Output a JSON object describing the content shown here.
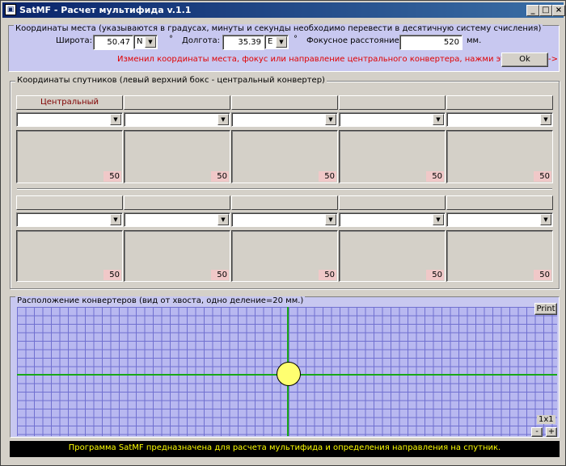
{
  "window": {
    "title": "SatMF - Расчет мультифида v.1.1",
    "minimize": "_",
    "maximize": "□",
    "close": "×"
  },
  "location": {
    "legend": "Координаты места (указываются в градусах, минуты  и секунды необходимо перевести в десятичную систему счисления)",
    "lat_label": "Широта:",
    "lat_value": "50.47",
    "lat_dir": "N",
    "lon_label": "Долгота:",
    "lon_value": "35.39",
    "lon_dir": "E",
    "degree": "°",
    "focus_label": "Фокусное расстояние:",
    "focus_value": "520",
    "focus_unit": "мм.",
    "hint": "Изменил координаты места, фокус или направление центрального конвертера, нажми эту кнопку -->",
    "ok_label": "Ok"
  },
  "satellites": {
    "legend": "Координаты спутников (левый верхний бокс - центральный конвертер)",
    "row1_headers": [
      "Центральный",
      "",
      "",
      "",
      ""
    ],
    "row1_badges": [
      "50",
      "50",
      "50",
      "50",
      "50"
    ],
    "row2_headers": [
      "",
      "",
      "",
      "",
      ""
    ],
    "row2_badges": [
      "50",
      "50",
      "50",
      "50",
      "50"
    ]
  },
  "layout_panel": {
    "legend": "Расположение конвертеров (вид от хвоста, одно деление=20 мм.)",
    "print_label": "Print",
    "scale": "1x1",
    "zoom_out": "-",
    "zoom_in": "+"
  },
  "status": "Программа SatMF предназначена для расчета мультифида и определения направления на спутник."
}
